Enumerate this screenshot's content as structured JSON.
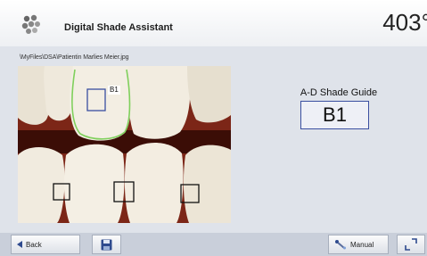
{
  "header": {
    "app_icon": "tooth-cluster-icon",
    "title": "Digital Shade Assistant",
    "temperature": "403°"
  },
  "file_path": "\\MyFiles\\DSA\\Patientin Marlies Meier.jpg",
  "photo": {
    "selection_label": "B1"
  },
  "shade_guide": {
    "label": "A-D Shade Guide",
    "value": "B1"
  },
  "footer": {
    "back_label": "Back",
    "back_icon": "back-arrow-icon",
    "save_icon": "floppy-disk-icon",
    "manual_label": "Manual",
    "manual_icon": "dropper-icon",
    "expand_icon": "expand-corner-icon"
  },
  "colors": {
    "accent_blue": "#3a4fa0",
    "selection_green": "#7fd05c"
  }
}
